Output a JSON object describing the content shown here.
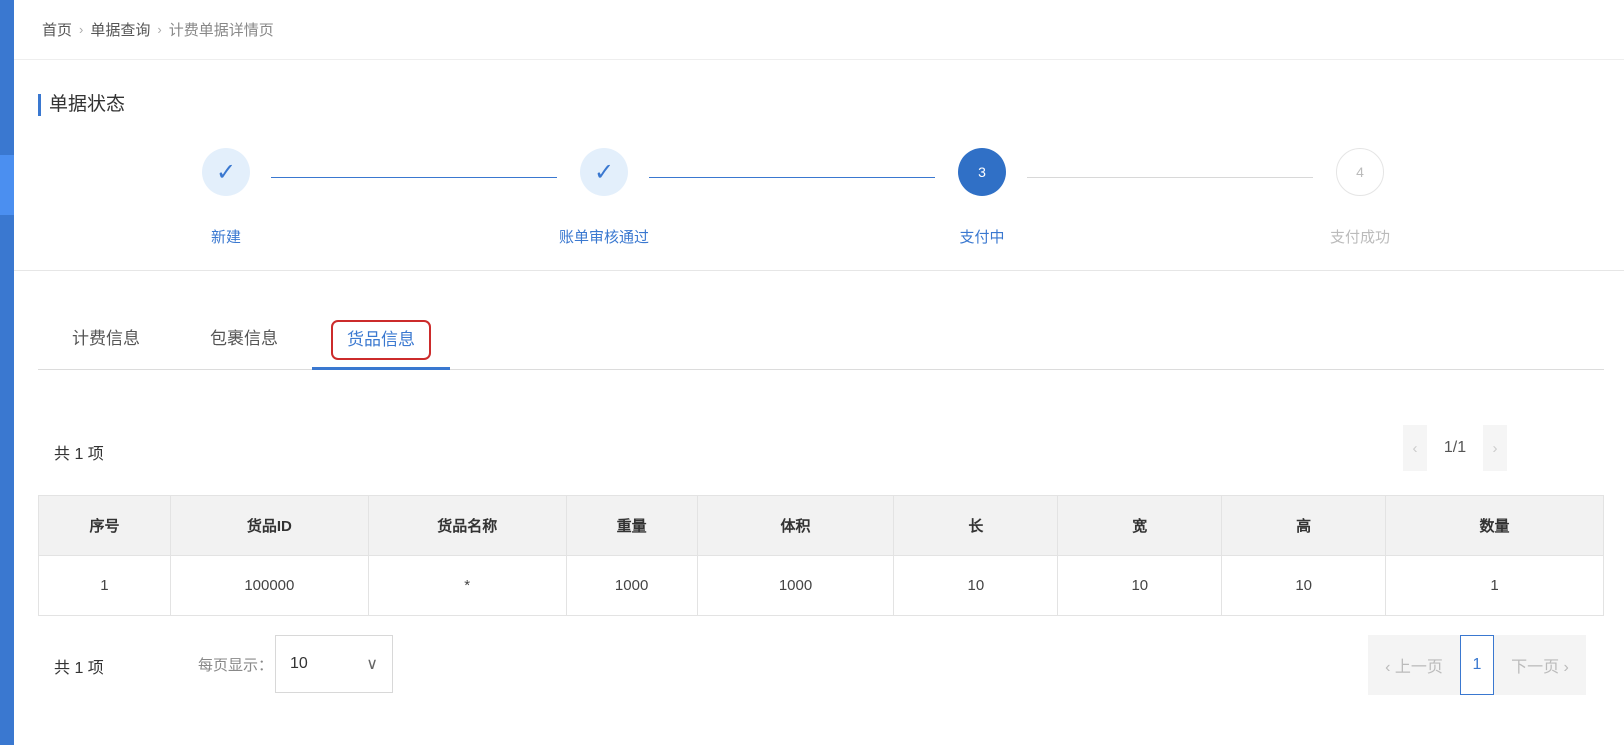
{
  "breadcrumb": {
    "items": [
      "首页",
      "单据查询",
      "计费单据详情页"
    ]
  },
  "status": {
    "title": "单据状态",
    "steps": [
      {
        "label": "新建",
        "state": "done",
        "mark": "✓"
      },
      {
        "label": "账单审核通过",
        "state": "done",
        "mark": "✓"
      },
      {
        "label": "支付中",
        "state": "active",
        "mark": "3"
      },
      {
        "label": "支付成功",
        "state": "wait",
        "mark": "4"
      }
    ]
  },
  "tabs": {
    "items": [
      "计费信息",
      "包裹信息",
      "货品信息"
    ],
    "active_index": 2
  },
  "summary": {
    "total_top": "共 1 项",
    "mini_pager_text": "1/1",
    "prev_glyph": "‹",
    "next_glyph": "›"
  },
  "table": {
    "headers": [
      "序号",
      "货品ID",
      "货品名称",
      "重量",
      "体积",
      "长",
      "宽",
      "高",
      "数量"
    ],
    "rows": [
      [
        "1",
        "100000",
        "*",
        "1000",
        "1000",
        "10",
        "10",
        "10",
        "1"
      ]
    ]
  },
  "footer": {
    "total_bottom": "共 1 项",
    "per_page_label": "每页显示：",
    "per_page_value": "10",
    "select_chevron": "∨",
    "prev_label": "‹ 上一页",
    "current_page": "1",
    "next_label": "下一页 ›"
  },
  "colors": {
    "accent": "#3a78d0",
    "active_step": "#3070c6",
    "highlight_box": "#cc2b2b",
    "sidebar": "#3a78d0"
  }
}
